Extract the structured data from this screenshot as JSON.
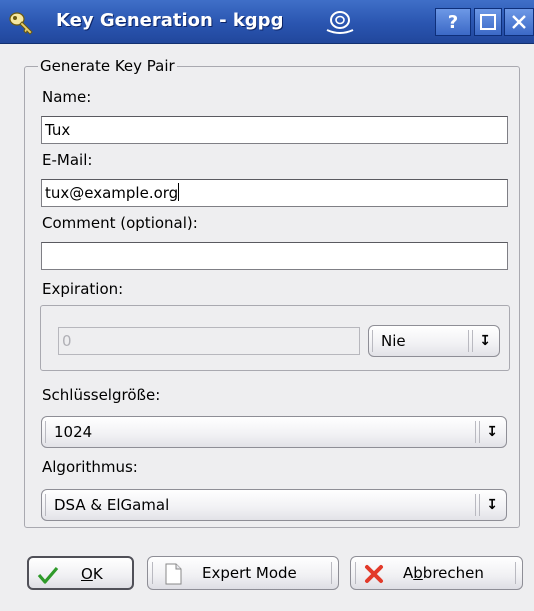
{
  "window": {
    "title": "Key Generation - kgpg",
    "help_button": "?",
    "colors": {
      "titlebar": "#2a55b0",
      "background": "#eeeef0"
    }
  },
  "form": {
    "group_title": "Generate Key Pair",
    "name": {
      "label": "Name:",
      "value": "Tux"
    },
    "email": {
      "label": "E-Mail:",
      "value": "tux@example.org"
    },
    "comment": {
      "label": "Comment (optional):",
      "value": ""
    },
    "expiration": {
      "label": "Expiration:",
      "value": "0",
      "unit": "Nie"
    },
    "keysize": {
      "label": "Schlüsselgröße:",
      "value": "1024"
    },
    "algorithm": {
      "label": "Algorithmus:",
      "value": "DSA & ElGamal"
    }
  },
  "buttons": {
    "ok": {
      "label_mnemonic": "O",
      "label_rest": "K",
      "icon": "checkmark-icon"
    },
    "expert": {
      "label": "Expert Mode",
      "icon": "document-icon"
    },
    "cancel": {
      "label_pre": "A",
      "label_mnemonic": "b",
      "label_rest": "brechen",
      "icon": "x-icon"
    }
  }
}
